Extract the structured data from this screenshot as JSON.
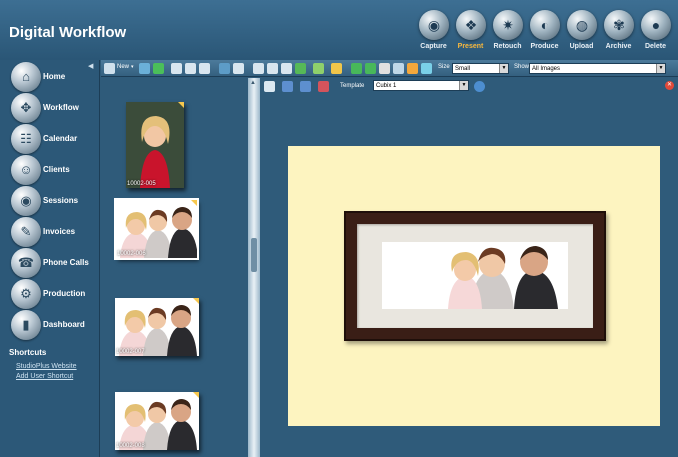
{
  "header": {
    "title": "Digital Workflow",
    "modes": [
      {
        "label": "Capture",
        "icon": "camera-lens-icon",
        "glyph": "◉",
        "active": false
      },
      {
        "label": "Present",
        "icon": "present-icon",
        "glyph": "❖",
        "active": true
      },
      {
        "label": "Retouch",
        "icon": "retouch-icon",
        "glyph": "✷",
        "active": false
      },
      {
        "label": "Produce",
        "icon": "produce-icon",
        "glyph": "◐",
        "active": false
      },
      {
        "label": "Upload",
        "icon": "upload-globe-icon",
        "glyph": "◍",
        "active": false
      },
      {
        "label": "Archive",
        "icon": "archive-icon",
        "glyph": "✾",
        "active": false
      },
      {
        "label": "Delete",
        "icon": "delete-icon",
        "glyph": "●",
        "active": false
      }
    ]
  },
  "nav": {
    "items": [
      {
        "label": "Home",
        "glyph": "⌂"
      },
      {
        "label": "Workflow",
        "glyph": "✥"
      },
      {
        "label": "Calendar",
        "glyph": "☷"
      },
      {
        "label": "Clients",
        "glyph": "☺"
      },
      {
        "label": "Sessions",
        "glyph": "◉"
      },
      {
        "label": "Invoices",
        "glyph": "✎"
      },
      {
        "label": "Phone Calls",
        "glyph": "☎"
      },
      {
        "label": "Production",
        "glyph": "⚙"
      },
      {
        "label": "Dashboard",
        "glyph": "▮"
      }
    ],
    "shortcuts_heading": "Shortcuts",
    "shortcuts": [
      "StudioPlus Website",
      "Add User Shortcut"
    ]
  },
  "toolbar": {
    "new_label": "New",
    "size_label": "Size",
    "size_value": "Small",
    "show_label": "Show",
    "show_value": "All Images"
  },
  "thumbnails": [
    {
      "id": "10002-005",
      "selected": false
    },
    {
      "id": "10002-006",
      "selected": true
    },
    {
      "id": "10002-007",
      "selected": false
    },
    {
      "id": "10002-008",
      "selected": false
    }
  ],
  "preview": {
    "template_label": "Template",
    "template_value": "Cubix 1"
  },
  "colors": {
    "background": "#2f5b7a",
    "mat": "#fdf4c0",
    "frame": "#3a1e16",
    "active_mode": "#f7b73c"
  }
}
